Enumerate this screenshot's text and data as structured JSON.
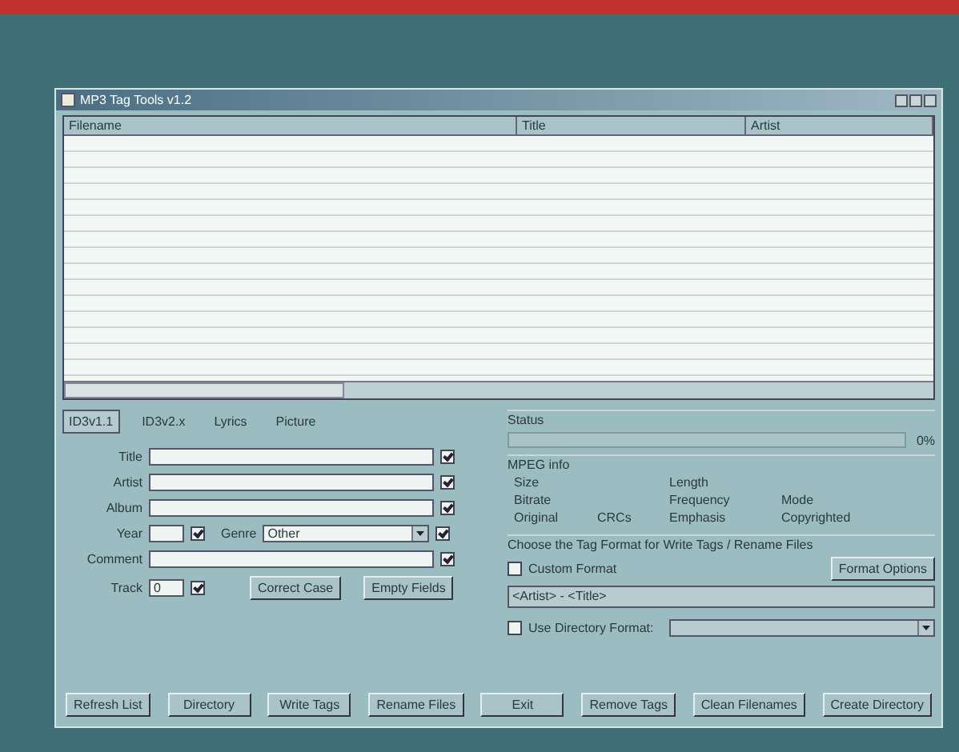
{
  "window": {
    "title": "MP3 Tag Tools v1.2"
  },
  "file_list": {
    "columns": [
      "Filename",
      "Title",
      "Artist"
    ]
  },
  "tabs": [
    {
      "label": "ID3v1.1",
      "selected": true
    },
    {
      "label": "ID3v2.x",
      "selected": false
    },
    {
      "label": "Lyrics",
      "selected": false
    },
    {
      "label": "Picture",
      "selected": false
    }
  ],
  "tag_fields": [
    {
      "label": "Title",
      "kind": "text",
      "checked": true
    },
    {
      "label": "Artist",
      "kind": "text",
      "checked": true
    },
    {
      "label": "Album",
      "kind": "text",
      "checked": true
    },
    {
      "label": "Year",
      "kind": "year",
      "checked": true,
      "genre_label": "Genre",
      "genre_value": "Other",
      "genre_checked": true
    },
    {
      "label": "Comment",
      "kind": "text",
      "checked": true
    },
    {
      "label": "Track",
      "kind": "track",
      "value": "0",
      "checked": true
    }
  ],
  "tag_buttons": [
    "Correct Case",
    "Empty Fields"
  ],
  "status": {
    "label": "Status",
    "level": 0,
    "reading": "0%"
  },
  "mpeg_info": {
    "title": "MPEG info",
    "rows": [
      [
        "Size",
        "",
        "Length",
        ""
      ],
      [
        "Bitrate",
        "",
        "Frequency",
        "Mode"
      ],
      [
        "Original",
        "CRCs",
        "Emphasis",
        "Copyrighted"
      ]
    ]
  },
  "format": {
    "title": "Choose the Tag Format for Write Tags / Rename Files",
    "custom_label": "Custom Format",
    "custom_checked": false,
    "options_button": "Format Options",
    "pattern": "<Artist> - <Title>",
    "directory_label": "Use Directory Format:",
    "directory_checked": false
  },
  "buttons": [
    "Refresh List",
    "Directory",
    "Write Tags",
    "Rename Files",
    "Exit",
    "Remove Tags",
    "Clean Filenames",
    "Create Directory"
  ]
}
